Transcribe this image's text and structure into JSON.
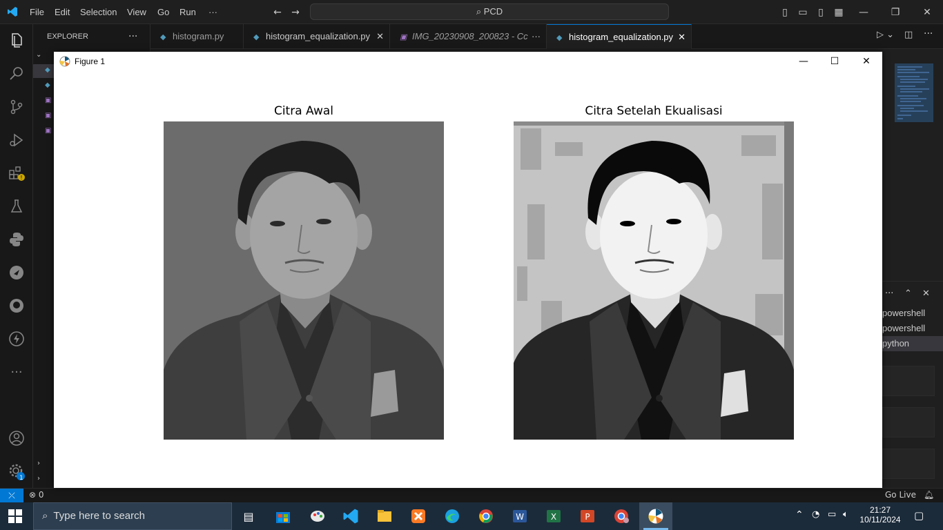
{
  "vscode": {
    "menu": [
      "File",
      "Edit",
      "Selection",
      "View",
      "Go",
      "Run",
      "···"
    ],
    "search_label": "PCD",
    "explorer_title": "EXPLORER",
    "explorer_more": "···",
    "tabs": [
      {
        "label": "histogram.py",
        "icon": "python-file-icon"
      },
      {
        "label": "histogram_equalization.py",
        "icon": "python-file-icon"
      },
      {
        "label": "IMG_20230908_200823 - Cc",
        "icon": "image-file-icon"
      },
      {
        "label": "histogram_equalization.py",
        "icon": "python-file-icon"
      }
    ],
    "terminal_items": [
      "powershell",
      "powershell",
      "python"
    ],
    "status": {
      "problems": "0",
      "go_live": "Go Live"
    },
    "settings_badge": "1"
  },
  "figure": {
    "window_title": "Figure 1",
    "left_title": "Citra Awal",
    "right_title": "Citra Setelah Ekualisasi"
  },
  "taskbar": {
    "search_placeholder": "Type here to search",
    "time": "21:27",
    "date": "10/11/2024"
  }
}
